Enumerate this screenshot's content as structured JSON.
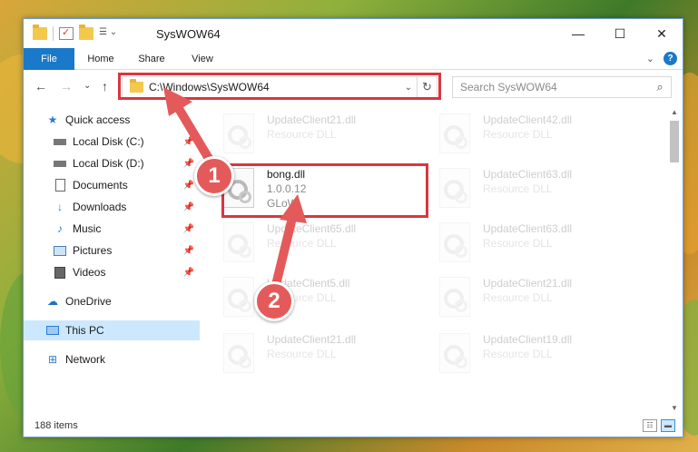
{
  "window": {
    "title": "SysWOW64",
    "controls": {
      "minimize": "—",
      "maximize": "☐",
      "close": "✕"
    }
  },
  "ribbon": {
    "tabs": [
      "File",
      "Home",
      "Share",
      "View"
    ],
    "collapse": "⌄",
    "help": "?"
  },
  "address": {
    "path": "C:\\Windows\\SysWOW64",
    "dropdown": "⌄",
    "refresh": "↻"
  },
  "search": {
    "placeholder": "Search SysWOW64"
  },
  "nav": {
    "back": "←",
    "forward": "→",
    "recent": "⌄",
    "up": "↑",
    "items": [
      {
        "label": "Quick access",
        "icon": "star-icon"
      },
      {
        "label": "Local Disk (C:)",
        "icon": "drive-icon",
        "pinned": true
      },
      {
        "label": "Local Disk (D:)",
        "icon": "drive-icon",
        "pinned": true
      },
      {
        "label": "Documents",
        "icon": "documents-icon",
        "pinned": true
      },
      {
        "label": "Downloads",
        "icon": "download-icon",
        "pinned": true
      },
      {
        "label": "Music",
        "icon": "music-icon",
        "pinned": true
      },
      {
        "label": "Pictures",
        "icon": "pictures-icon",
        "pinned": true
      },
      {
        "label": "Videos",
        "icon": "videos-icon",
        "pinned": true
      },
      {
        "label": "OneDrive",
        "icon": "cloud-icon"
      },
      {
        "label": "This PC",
        "icon": "computer-icon",
        "selected": true
      },
      {
        "label": "Network",
        "icon": "network-icon"
      }
    ]
  },
  "files": [
    {
      "name": "UpdateClient21.dll",
      "sub": "Resource DLL",
      "faded": true
    },
    {
      "name": "UpdateClient42.dll",
      "sub": "Resource DLL",
      "faded": true
    },
    {
      "name": "bong.dll",
      "version": "1.0.0.12",
      "company": "GLoW",
      "faded": false,
      "highlight": true
    },
    {
      "name": "UpdateClient63.dll",
      "sub": "Resource DLL",
      "faded": true
    },
    {
      "name": "UpdateClient65.dll",
      "sub": "Resource DLL",
      "faded": true
    },
    {
      "name": "UpdateClient63.dll",
      "sub": "Resource DLL",
      "faded": true
    },
    {
      "name": "UpdateClient5.dll",
      "sub": "Resource DLL",
      "faded": true
    },
    {
      "name": "UpdateClient21.dll",
      "sub": "Resource DLL",
      "faded": true
    },
    {
      "name": "UpdateClient21.dll",
      "sub": "Resource DLL",
      "faded": true
    },
    {
      "name": "UpdateClient19.dll",
      "sub": "Resource DLL",
      "faded": true
    }
  ],
  "status": {
    "items": "188 items"
  },
  "annotations": {
    "step1": "1",
    "step2": "2",
    "color": "#e45a5a",
    "box_color": "#d9363e"
  }
}
